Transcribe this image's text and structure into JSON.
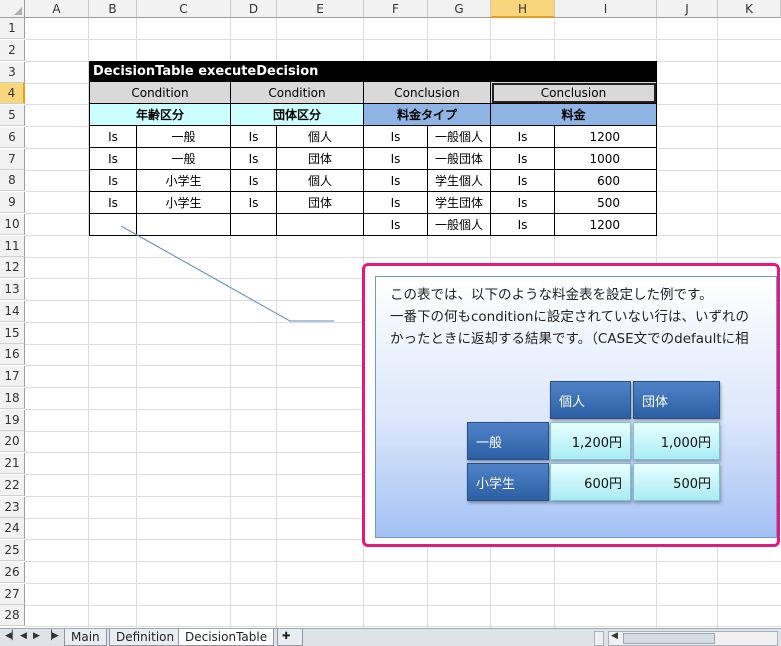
{
  "columns": [
    "A",
    "B",
    "C",
    "D",
    "E",
    "F",
    "G",
    "H",
    "I",
    "J",
    "K"
  ],
  "rows": [
    "1",
    "2",
    "3",
    "4",
    "5",
    "6",
    "7",
    "8",
    "9",
    "10",
    "11",
    "12",
    "13",
    "14",
    "15",
    "16",
    "17",
    "18",
    "19",
    "20",
    "21",
    "22",
    "23",
    "24",
    "25",
    "26",
    "27",
    "28"
  ],
  "selected_column": "H",
  "selected_row": "4",
  "decision_table": {
    "title": "DecisionTable executeDecision",
    "types": [
      "Condition",
      "Condition",
      "Conclusion",
      "Conclusion"
    ],
    "names": [
      "年齢区分",
      "団体区分",
      "料金タイプ",
      "料金"
    ],
    "rows": [
      [
        "Is",
        "一般",
        "Is",
        "個人",
        "Is",
        "一般個人",
        "Is",
        "1200"
      ],
      [
        "Is",
        "一般",
        "Is",
        "団体",
        "Is",
        "一般団体",
        "Is",
        "1000"
      ],
      [
        "Is",
        "小学生",
        "Is",
        "個人",
        "Is",
        "学生個人",
        "Is",
        "600"
      ],
      [
        "Is",
        "小学生",
        "Is",
        "団体",
        "Is",
        "学生団体",
        "Is",
        "500"
      ],
      [
        "",
        "",
        "",
        "",
        "Is",
        "一般個人",
        "Is",
        "1200"
      ]
    ]
  },
  "callout": {
    "line1": "この表では、以下のような料金表を設定した例です。",
    "line2": "一番下の何もconditionに設定されていない行は、いずれの",
    "line3": "かったときに返却する結果です。（CASE文でのdefaultに相",
    "price_table": {
      "col_headers": [
        "個人",
        "団体"
      ],
      "rows": [
        {
          "label": "一般",
          "values": [
            "1,200円",
            "1,000円"
          ]
        },
        {
          "label": "小学生",
          "values": [
            "600円",
            "500円"
          ]
        }
      ]
    }
  },
  "sheet_tabs": [
    "Main",
    "Definition",
    "DecisionTable"
  ],
  "active_tab": "DecisionTable",
  "colors": {
    "callout_border": "#e3197d",
    "title_bg": "#000000",
    "condition_name_bg": "#ccffff",
    "conclusion_name_bg": "#8db4e2",
    "selected_header": "#f9d67c"
  }
}
